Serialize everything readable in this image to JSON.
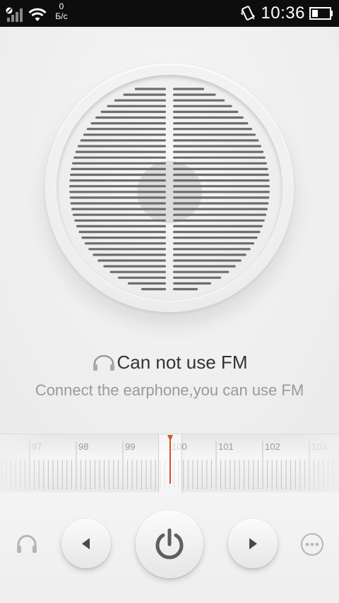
{
  "status_bar": {
    "speed_value": "0",
    "speed_unit": "Б/с",
    "time": "10:36"
  },
  "message": {
    "title": "Can not use FM",
    "subtitle": "Connect the earphone,you can use FM"
  },
  "tuner": {
    "frequencies": [
      "97",
      "98",
      "99",
      "100",
      "101",
      "102",
      "103"
    ],
    "current": "100"
  },
  "controls": {
    "left_icon": "headset-icon",
    "prev_icon": "prev-triangle-icon",
    "power_icon": "power-icon",
    "next_icon": "next-triangle-icon",
    "right_icon": "more-icon"
  },
  "colors": {
    "needle": "#d9532b",
    "status_bar_bg": "#0d0d0d",
    "speaker_slot": "#6d6d6d"
  }
}
